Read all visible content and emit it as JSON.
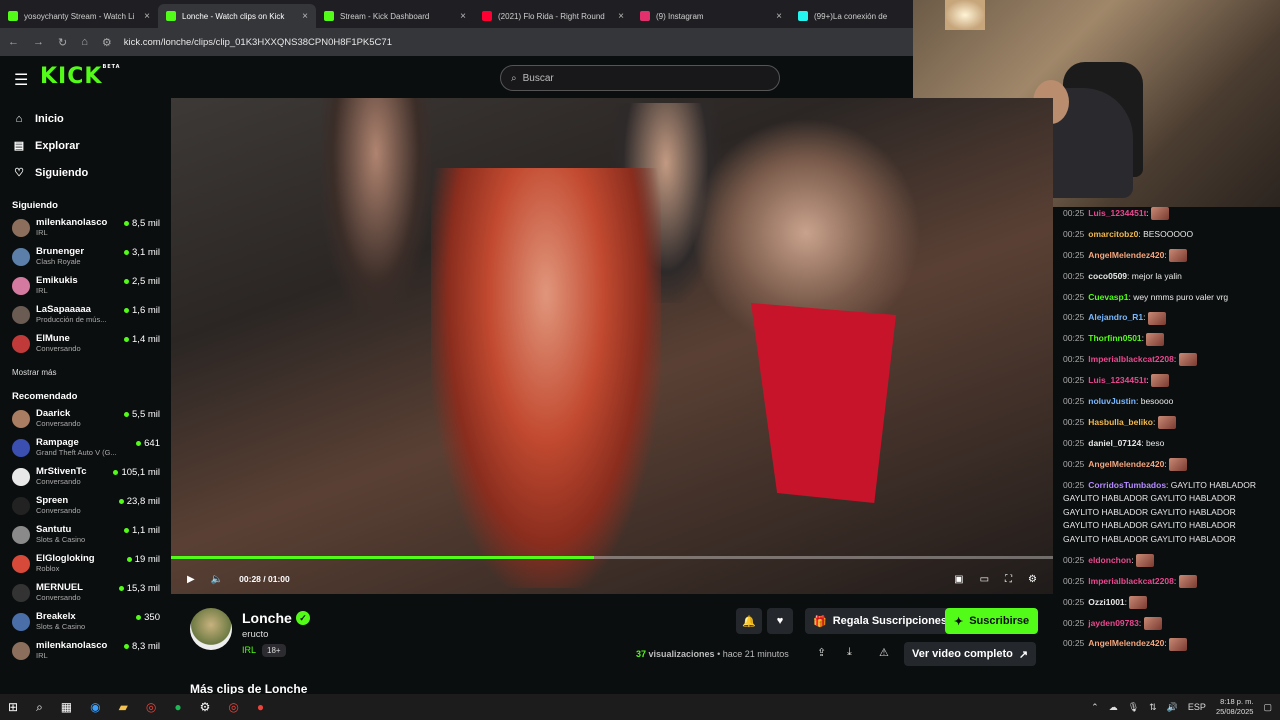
{
  "browser": {
    "tabs": [
      {
        "label": "yosoychanty Stream - Watch Li",
        "fav": "#53fc18"
      },
      {
        "label": "Lonche - Watch clips on Kick",
        "fav": "#53fc18",
        "active": true
      },
      {
        "label": "Stream - Kick Dashboard",
        "fav": "#53fc18"
      },
      {
        "label": "(2021) Flo Rida - Right Round",
        "fav": "#ff0033"
      },
      {
        "label": "(9) Instagram",
        "fav": "#e1306c"
      },
      {
        "label": "(99+)La conexión de",
        "fav": "#25f4ee"
      }
    ],
    "url": "kick.com/lonche/clips/clip_01K3HXXQNS38CPN0H8F1PK5C71"
  },
  "site": {
    "logo": "KICK",
    "logo_badge": "BETA",
    "search_placeholder": "Buscar"
  },
  "sidebar": {
    "nav": [
      {
        "label": "Inicio",
        "icon": "⌂"
      },
      {
        "label": "Explorar",
        "icon": "▤"
      },
      {
        "label": "Siguiendo",
        "icon": "♡"
      }
    ],
    "following_title": "Siguiendo",
    "following": [
      {
        "name": "milenkanolasco",
        "cat": "IRL",
        "viewers": "8,5 mil",
        "color": "#8b6f5c"
      },
      {
        "name": "Brunenger",
        "cat": "Clash Royale",
        "viewers": "3,1 mil",
        "color": "#5b7fa8"
      },
      {
        "name": "Emikukis",
        "cat": "IRL",
        "viewers": "2,5 mil",
        "color": "#d47aa0"
      },
      {
        "name": "LaSapaaaaa",
        "cat": "Producción de mús...",
        "viewers": "1,6 mil",
        "color": "#6a5b53"
      },
      {
        "name": "ElMune",
        "cat": "Conversando",
        "viewers": "1,4 mil",
        "color": "#c03a3a"
      }
    ],
    "show_more": "Mostrar más",
    "recommended_title": "Recomendado",
    "recommended": [
      {
        "name": "Daarick",
        "cat": "Conversando",
        "viewers": "5,5 mil",
        "color": "#a87d62"
      },
      {
        "name": "Rampage",
        "cat": "Grand Theft Auto V (G...",
        "viewers": "641",
        "color": "#3a4fb0"
      },
      {
        "name": "MrStivenTc",
        "cat": "Conversando",
        "viewers": "105,1 mil",
        "color": "#e8e8e8"
      },
      {
        "name": "Spreen",
        "cat": "Conversando",
        "viewers": "23,8 mil",
        "color": "#222"
      },
      {
        "name": "Santutu",
        "cat": "Slots & Casino",
        "viewers": "1,1 mil",
        "color": "#8a8a8a"
      },
      {
        "name": "ElGlogloking",
        "cat": "Roblox",
        "viewers": "19 mil",
        "color": "#d74a3a"
      },
      {
        "name": "MERNUEL",
        "cat": "Conversando",
        "viewers": "15,3 mil",
        "color": "#333"
      },
      {
        "name": "Breakelx",
        "cat": "Slots & Casino",
        "viewers": "350",
        "color": "#4a6ea8"
      },
      {
        "name": "milenkanolasco",
        "cat": "IRL",
        "viewers": "8,3 mil",
        "color": "#8b6f5c"
      }
    ]
  },
  "player": {
    "time_current": "00:28",
    "time_total": "01:00",
    "progress": 0.48
  },
  "clip": {
    "channel": "Lonche",
    "title": "eructo",
    "category": "IRL",
    "age": "18+",
    "gift_label": "Regala Suscripciones",
    "subscribe_label": "Suscribirse",
    "views_count": "37",
    "views_label": "visualizaciones",
    "ago": "• hace 21 minutos",
    "full_video_label": "Ver video completo",
    "more_clips": "Más clips de Lonche"
  },
  "chat": [
    {
      "ts": "00:25",
      "user": "Luis_1234451t",
      "color": "#e9498f",
      "text": "",
      "emote": true
    },
    {
      "ts": "00:25",
      "user": "omarcitobz0",
      "color": "#f2b84b",
      "text": "BESOOOOO"
    },
    {
      "ts": "00:25",
      "user": "AngelMelendez420",
      "color": "#f4a77f",
      "text": "",
      "emote": true
    },
    {
      "ts": "00:25",
      "user": "coco0509",
      "color": "#e8e8e8",
      "text": "mejor la yalin"
    },
    {
      "ts": "00:25",
      "user": "Cuevasp1",
      "color": "#53fc18",
      "text": "wey nmms puro valer vrg"
    },
    {
      "ts": "00:25",
      "user": "Alejandro_R1",
      "color": "#7ab8ff",
      "text": "",
      "emote": true
    },
    {
      "ts": "00:25",
      "user": "Thorfinn0501",
      "color": "#53fc18",
      "text": "",
      "emote": true
    },
    {
      "ts": "00:25",
      "user": "Imperialblackcat2208",
      "color": "#e9498f",
      "text": "",
      "emote": true
    },
    {
      "ts": "00:25",
      "user": "Luis_1234451t",
      "color": "#e9498f",
      "text": "",
      "emote": true
    },
    {
      "ts": "00:25",
      "user": "noluvJustin",
      "color": "#7ab8ff",
      "text": "besoooo"
    },
    {
      "ts": "00:25",
      "user": "Hasbulla_beliko",
      "color": "#f2b84b",
      "text": "",
      "emote": true
    },
    {
      "ts": "00:25",
      "user": "daniel_07124",
      "color": "#e8e8e8",
      "text": "beso"
    },
    {
      "ts": "00:25",
      "user": "AngelMelendez420",
      "color": "#f4a77f",
      "text": "",
      "emote": true
    },
    {
      "ts": "00:25",
      "user": "CorridosTumbados",
      "color": "#b58cff",
      "text": "GAYLITO HABLADOR GAYLITO HABLADOR GAYLITO HABLADOR GAYLITO HABLADOR GAYLITO HABLADOR GAYLITO HABLADOR GAYLITO HABLADOR GAYLITO HABLADOR GAYLITO HABLADOR"
    },
    {
      "ts": "00:25",
      "user": "eldonchon",
      "color": "#e9498f",
      "text": "",
      "emote": true
    },
    {
      "ts": "00:25",
      "user": "Imperialblackcat2208",
      "color": "#e9498f",
      "text": "",
      "emote": true
    },
    {
      "ts": "00:25",
      "user": "Ozzi1001",
      "color": "#e8e8e8",
      "text": "",
      "emote": true
    },
    {
      "ts": "00:25",
      "user": "jayden09783",
      "color": "#e9498f",
      "text": "",
      "emote": true
    },
    {
      "ts": "00:25",
      "user": "AngelMelendez420",
      "color": "#f4a77f",
      "text": "",
      "emote": true
    }
  ],
  "taskbar": {
    "lang": "ESP",
    "time": "8:18 p. m.",
    "date": "25/08/2025"
  }
}
